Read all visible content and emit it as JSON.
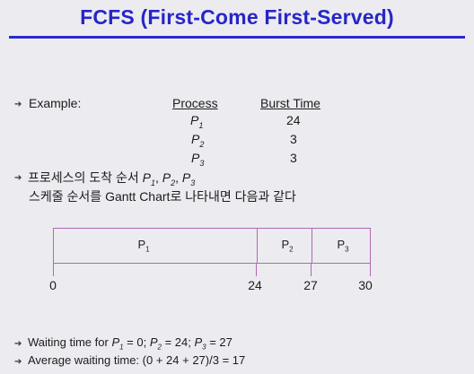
{
  "title": "FCFS (First-Come First-Served)",
  "example_label": "Example:",
  "table": {
    "header_process": "Process",
    "header_burst": "Burst Time",
    "rows": [
      {
        "p": "P",
        "sub": "1",
        "burst": "24"
      },
      {
        "p": "P",
        "sub": "2",
        "burst": "3"
      },
      {
        "p": "P",
        "sub": "3",
        "burst": "3"
      }
    ]
  },
  "arrival": {
    "prefix": "프로세스의 도착 순서 ",
    "p": "P",
    "subs": [
      "1",
      "2",
      "3"
    ],
    "sep": ", "
  },
  "schedule_line": {
    "before": "스케줄 순서를 ",
    "gantt": "Gantt Chart",
    "after": "로 나타내면 다음과 같다"
  },
  "gantt": {
    "cells": [
      {
        "p": "P",
        "sub": "1",
        "start": 0,
        "end": 24
      },
      {
        "p": "P",
        "sub": "2",
        "start": 24,
        "end": 27
      },
      {
        "p": "P",
        "sub": "3",
        "start": 27,
        "end": 30
      }
    ],
    "ticks": [
      "0",
      "24",
      "27",
      "30"
    ]
  },
  "waiting": {
    "label": "Waiting time for ",
    "p1": "P",
    "s1": "1",
    "v1": " = 0; ",
    "p2": "P",
    "s2": "2",
    "v2": " = 24; ",
    "p3": "P",
    "s3": "3",
    "v3": " = 27"
  },
  "average": {
    "label": "Average waiting time:  ",
    "formula": "(0 + 24 + 27)/3 = 17"
  },
  "bullet_glyph": "➔"
}
